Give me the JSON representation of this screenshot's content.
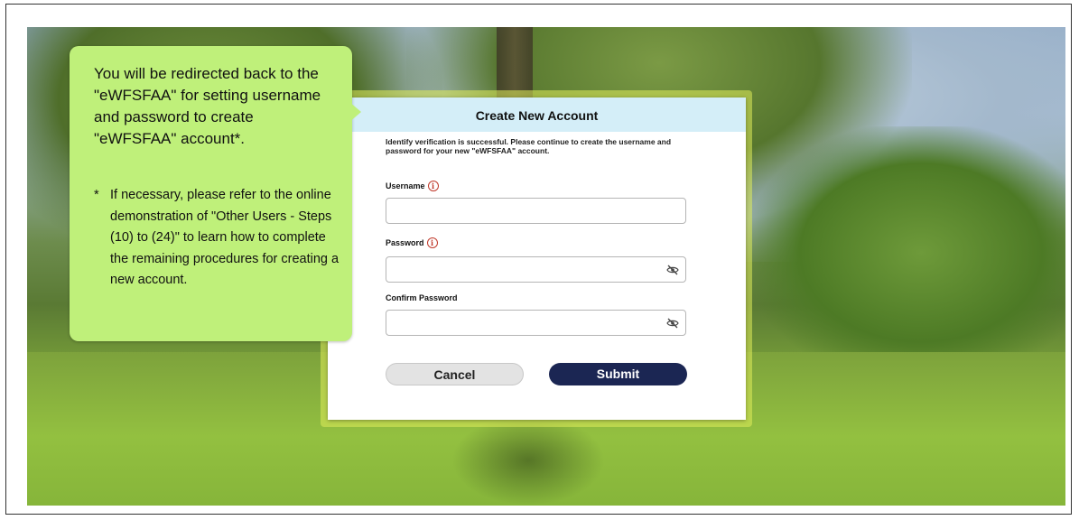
{
  "callout": {
    "message": "You will be redirected back to the \"eWFSFAA\" for setting username and password to create \"eWFSFAA\" account*.",
    "note_marker": "*",
    "note": "If necessary, please refer to the online demonstration of \"Other Users - Steps (10) to (24)\" to learn how to complete the remaining procedures for creating a new account."
  },
  "dialog": {
    "title": "Create New Account",
    "message": "Identify verification is successful. Please continue to create the username and password for your new \"eWFSFAA\" account.",
    "fields": {
      "username": {
        "label": "Username",
        "value": "",
        "info_icon": "i"
      },
      "password": {
        "label": "Password",
        "value": "",
        "info_icon": "i"
      },
      "confirm_password": {
        "label": "Confirm Password",
        "value": ""
      }
    },
    "cancel_label": "Cancel",
    "submit_label": "Submit"
  },
  "colors": {
    "callout_bg": "#bff07a",
    "header_bg": "#d4eef8",
    "submit_bg": "#1b2653",
    "info_red": "#c0392b"
  }
}
